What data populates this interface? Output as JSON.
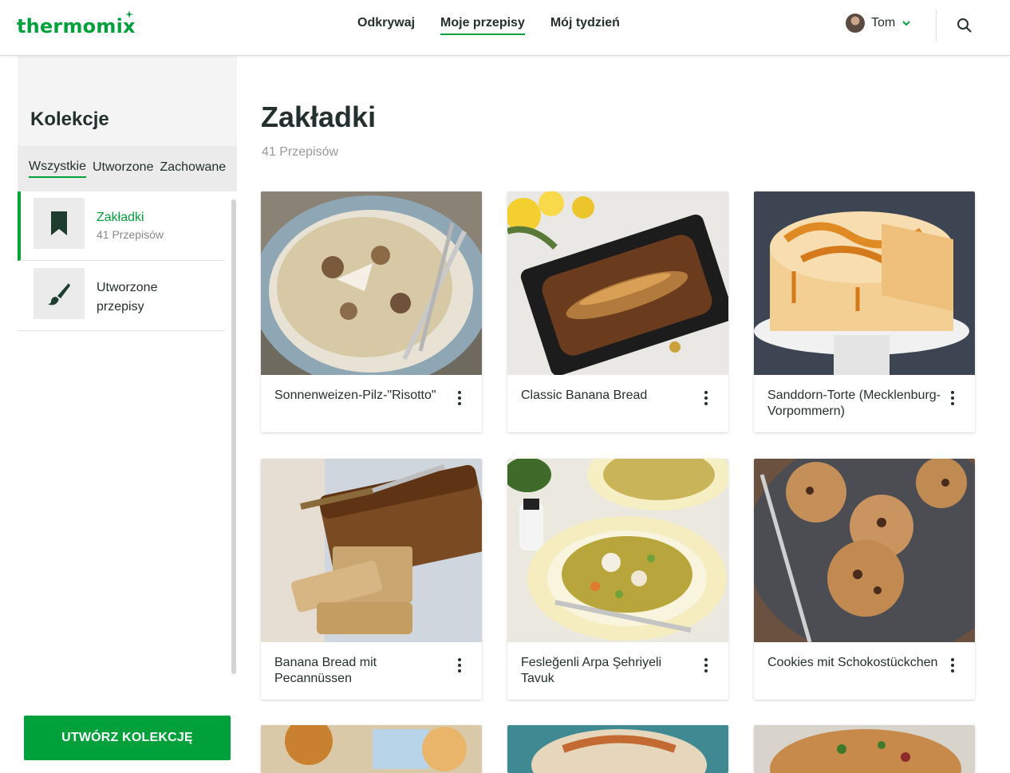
{
  "header": {
    "logo": "thermomix",
    "nav": [
      {
        "label": "Odkrywaj",
        "active": false
      },
      {
        "label": "Moje przepisy",
        "active": true
      },
      {
        "label": "Mój tydzień",
        "active": false
      }
    ],
    "user_name": "Tom",
    "icons": [
      "chevron-down-icon",
      "search-icon"
    ]
  },
  "sidebar": {
    "title": "Kolekcje",
    "tabs": [
      {
        "label": "Wszystkie",
        "active": true
      },
      {
        "label": "Utworzone",
        "active": false
      },
      {
        "label": "Zachowane",
        "active": false
      }
    ],
    "collections": [
      {
        "name": "Zakładki",
        "count": "41 Przepisów",
        "icon": "bookmark-icon",
        "active": true
      },
      {
        "name": "Utworzone przepisy",
        "count": "",
        "icon": "brush-icon",
        "active": false
      }
    ],
    "create_button": "UTWÓRZ KOLEKCJĘ"
  },
  "main": {
    "title": "Zakładki",
    "subtitle": "41 Przepisów",
    "recipes": [
      {
        "title": "Sonnenweizen-Pilz-\"Risotto\""
      },
      {
        "title": "Classic Banana Bread"
      },
      {
        "title": "Sanddorn-Torte (Mecklenburg-Vorpommern)"
      },
      {
        "title": "Banana Bread mit Pecannüssen"
      },
      {
        "title": "Fesleğenli Arpa Şehriyeli Tavuk"
      },
      {
        "title": "Cookies mit Schokostückchen"
      }
    ]
  },
  "colors": {
    "brand_green": "#00a13b",
    "text_dark": "#23302e",
    "muted": "#999999"
  }
}
